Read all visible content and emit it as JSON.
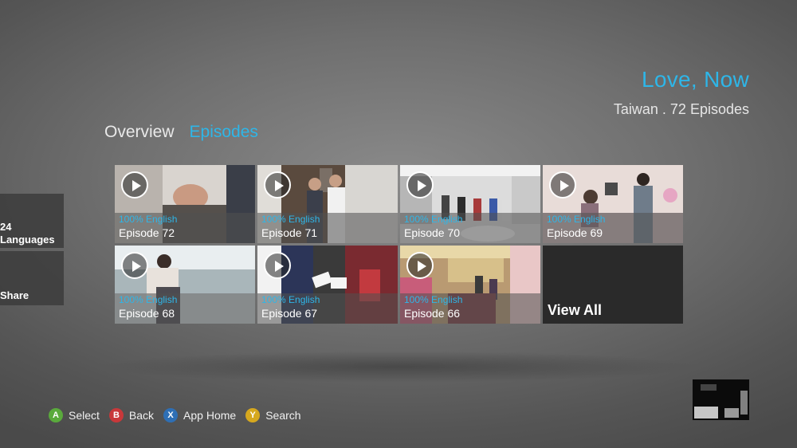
{
  "header": {
    "title": "Love, Now",
    "meta": "Taiwan . 72 Episodes"
  },
  "tabs": [
    {
      "label": "Overview",
      "active": false
    },
    {
      "label": "Episodes",
      "active": true
    }
  ],
  "side_tiles": {
    "languages": {
      "line1": "24",
      "line2": "Languages"
    },
    "share": {
      "label": "Share"
    }
  },
  "episodes": [
    {
      "title": "Episode 72",
      "language": "100% English",
      "scene": "scene-hands-bag"
    },
    {
      "title": "Episode 71",
      "language": "100% English",
      "scene": "scene-couple-room"
    },
    {
      "title": "Episode 70",
      "language": "100% English",
      "scene": "scene-white-lobby"
    },
    {
      "title": "Episode 69",
      "language": "100% English",
      "scene": "scene-pink-room"
    },
    {
      "title": "Episode 68",
      "language": "100% English",
      "scene": "scene-balcony"
    },
    {
      "title": "Episode 67",
      "language": "100% English",
      "scene": "scene-envelope"
    },
    {
      "title": "Episode 66",
      "language": "100% English",
      "scene": "scene-shop"
    }
  ],
  "view_all_label": "View All",
  "controls": [
    {
      "key": "A",
      "label": "Select",
      "color": "#5aaa3c"
    },
    {
      "key": "B",
      "label": "Back",
      "color": "#c8383a"
    },
    {
      "key": "X",
      "label": "App Home",
      "color": "#2e6fb5"
    },
    {
      "key": "Y",
      "label": "Search",
      "color": "#d6a81e"
    }
  ],
  "colors": {
    "accent": "#2eb6e8",
    "background": "#6f6f6f"
  }
}
